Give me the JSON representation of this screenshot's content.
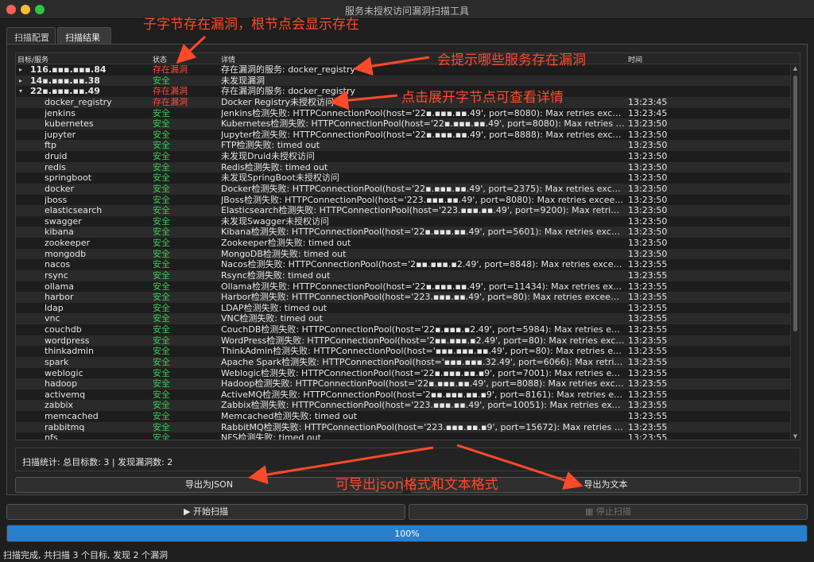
{
  "window": {
    "title": "服务未授权访问漏洞扫描工具",
    "tabs": [
      "扫描配置",
      "扫描结果"
    ],
    "active_tab": "扫描结果"
  },
  "colors": {
    "safe": "#3ccb54",
    "vulnerable": "#ff4c3b",
    "accent": "#2a7fcc",
    "annotation": "#ff4a2a"
  },
  "tree": {
    "headers": {
      "name": "目标/服务",
      "status": "状态",
      "detail": "详情",
      "time": "时间"
    },
    "top": [
      {
        "name": "116.▪▪▪.▪▪▪.84",
        "status": "存在漏洞",
        "status_type": "vuln",
        "detail": "存在漏洞的服务: docker_registry",
        "time": "",
        "caret": "▸"
      },
      {
        "name": "14▪.▪▪▪.▪▪.38",
        "status": "安全",
        "status_type": "safe",
        "detail": "未发现漏洞",
        "time": "",
        "caret": "▸"
      },
      {
        "name": "22▪.▪▪▪.▪▪.49",
        "status": "存在漏洞",
        "status_type": "vuln",
        "detail": "存在漏洞的服务: docker_registry",
        "time": "",
        "caret": "▾"
      }
    ],
    "children": [
      {
        "name": "docker_registry",
        "status": "存在漏洞",
        "status_type": "vuln",
        "detail": "Docker Registry未授权访问",
        "time": "13:23:45"
      },
      {
        "name": "jenkins",
        "status": "安全",
        "status_type": "safe",
        "detail": "Jenkins检测失败: HTTPConnectionPool(host='22▪.▪▪▪.▪▪.49', port=8080): Max retries exceeded wi...",
        "time": "13:23:45"
      },
      {
        "name": "kubernetes",
        "status": "安全",
        "status_type": "safe",
        "detail": "Kubernetes检测失败: HTTPConnectionPool(host='22▪.▪▪▪.▪▪.49', port=8080): Max retries exceede...",
        "time": "13:23:50"
      },
      {
        "name": "jupyter",
        "status": "安全",
        "status_type": "safe",
        "detail": "Jupyter检测失败: HTTPConnectionPool(host='22▪.▪▪▪.▪▪.49', port=8888): Max retries exceeded wi...",
        "time": "13:23:50"
      },
      {
        "name": "ftp",
        "status": "安全",
        "status_type": "safe",
        "detail": "FTP检测失败: timed out",
        "time": "13:23:50"
      },
      {
        "name": "druid",
        "status": "安全",
        "status_type": "safe",
        "detail": "未发现Druid未授权访问",
        "time": "13:23:50"
      },
      {
        "name": "redis",
        "status": "安全",
        "status_type": "safe",
        "detail": "Redis检测失败: timed out",
        "time": "13:23:50"
      },
      {
        "name": "springboot",
        "status": "安全",
        "status_type": "safe",
        "detail": "未发现SpringBoot未授权访问",
        "time": "13:23:50"
      },
      {
        "name": "docker",
        "status": "安全",
        "status_type": "safe",
        "detail": "Docker检测失败: HTTPConnectionPool(host='22▪.▪▪▪.▪▪.49', port=2375): Max retries exceeded wit...",
        "time": "13:23:50"
      },
      {
        "name": "jboss",
        "status": "安全",
        "status_type": "safe",
        "detail": "JBoss检测失败: HTTPConnectionPool(host='223.▪▪▪.▪▪.49', port=8080): Max retries exceeded with...",
        "time": "13:23:50"
      },
      {
        "name": "elasticsearch",
        "status": "安全",
        "status_type": "safe",
        "detail": "Elasticsearch检测失败: HTTPConnectionPool(host='223.▪▪▪.▪▪.49', port=9200): Max retries exceed...",
        "time": "13:23:50"
      },
      {
        "name": "swagger",
        "status": "安全",
        "status_type": "safe",
        "detail": "未发现Swagger未授权访问",
        "time": "13:23:50"
      },
      {
        "name": "kibana",
        "status": "安全",
        "status_type": "safe",
        "detail": "Kibana检测失败: HTTPConnectionPool(host='22▪.▪▪▪.▪▪.49', port=5601): Max retries exceeded wit...",
        "time": "13:23:50"
      },
      {
        "name": "zookeeper",
        "status": "安全",
        "status_type": "safe",
        "detail": "Zookeeper检测失败: timed out",
        "time": "13:23:50"
      },
      {
        "name": "mongodb",
        "status": "安全",
        "status_type": "safe",
        "detail": "MongoDB检测失败: timed out",
        "time": "13:23:50"
      },
      {
        "name": "nacos",
        "status": "安全",
        "status_type": "safe",
        "detail": "Nacos检测失败: HTTPConnectionPool(host='2▪▪.▪▪▪.▪2.49', port=8848): Max retries exceeded with...",
        "time": "13:23:55"
      },
      {
        "name": "rsync",
        "status": "安全",
        "status_type": "safe",
        "detail": "Rsync检测失败: timed out",
        "time": "13:23:55"
      },
      {
        "name": "ollama",
        "status": "安全",
        "status_type": "safe",
        "detail": "Ollama检测失败: HTTPConnectionPool(host='22▪.▪▪▪.▪▪.49', port=11434): Max retries exceeded wit...",
        "time": "13:23:55"
      },
      {
        "name": "harbor",
        "status": "安全",
        "status_type": "safe",
        "detail": "Harbor检测失败: HTTPConnectionPool(host='223.▪▪▪.▪▪.49', port=80): Max retries exceeded with u...",
        "time": "13:23:55"
      },
      {
        "name": "ldap",
        "status": "安全",
        "status_type": "safe",
        "detail": "LDAP检测失败: timed out",
        "time": "13:23:55"
      },
      {
        "name": "vnc",
        "status": "安全",
        "status_type": "safe",
        "detail": "VNC检测失败: timed out",
        "time": "13:23:55"
      },
      {
        "name": "couchdb",
        "status": "安全",
        "status_type": "safe",
        "detail": "CouchDB检测失败: HTTPConnectionPool(host='22▪.▪▪▪.▪2.49', port=5984): Max retries exceeded...",
        "time": "13:23:55"
      },
      {
        "name": "wordpress",
        "status": "安全",
        "status_type": "safe",
        "detail": "WordPress检测失败: HTTPConnectionPool(host='2▪▪.▪▪▪.▪2.49', port=80): Max retries exceeded wi...",
        "time": "13:23:55"
      },
      {
        "name": "thinkadmin",
        "status": "安全",
        "status_type": "safe",
        "detail": "ThinkAdmin检测失败: HTTPConnectionPool(host='▪▪▪.▪▪▪.▪▪.49', port=80): Max retries exceed...",
        "time": "13:23:55"
      },
      {
        "name": "spark",
        "status": "安全",
        "status_type": "safe",
        "detail": "Apache Spark检测失败: HTTPConnectionPool(host='▪▪▪.▪▪▪.32.49', port=6066): Max retries exce...",
        "time": "13:23:55"
      },
      {
        "name": "weblogic",
        "status": "安全",
        "status_type": "safe",
        "detail": "Weblogic检测失败: HTTPConnectionPool(host='22▪.▪▪▪.▪▪.▪9', port=7001): Max retries exceeded wit...",
        "time": "13:23:55"
      },
      {
        "name": "hadoop",
        "status": "安全",
        "status_type": "safe",
        "detail": "Hadoop检测失败: HTTPConnectionPool(host='22▪.▪▪▪.▪▪.49', port=8088): Max retries exceeded wit...",
        "time": "13:23:55"
      },
      {
        "name": "activemq",
        "status": "安全",
        "status_type": "safe",
        "detail": "ActiveMQ检测失败: HTTPConnectionPool(host='2▪▪.▪▪▪.▪▪.▪9', port=8161): Max retries exceeded wi...",
        "time": "13:23:55"
      },
      {
        "name": "zabbix",
        "status": "安全",
        "status_type": "safe",
        "detail": "Zabbix检测失败: HTTPConnectionPool(host='223.▪▪▪.▪▪.49', port=10051): Max retries exceeded wit...",
        "time": "13:23:55"
      },
      {
        "name": "memcached",
        "status": "安全",
        "status_type": "safe",
        "detail": "Memcached检测失败: timed out",
        "time": "13:23:55"
      },
      {
        "name": "rabbitmq",
        "status": "安全",
        "status_type": "safe",
        "detail": "RabbitMQ检测失败: HTTPConnectionPool(host='223.▪▪▪.▪▪.▪9', port=15672): Max retries exceede...",
        "time": "13:23:55"
      },
      {
        "name": "nfs",
        "status": "安全",
        "status_type": "safe",
        "detail": "NFS检测失败: timed out",
        "time": "13:23:55"
      }
    ]
  },
  "stats": {
    "text": "扫描统计: 总目标数: 3 | 发现漏洞数: 2"
  },
  "buttons": {
    "export_json": "导出为JSON",
    "export_text": "导出为文本",
    "start_scan": "▶ 开始扫描",
    "stop_scan": "▦ 停止扫描"
  },
  "progress": {
    "value": 100,
    "label": "100%"
  },
  "statusbar": {
    "text": "扫描完成, 共扫描 3 个目标, 发现 2 个漏洞"
  },
  "annotations": {
    "child_vuln": "子字节存在漏洞，根节点会显示存在",
    "which_services": "会提示哪些服务存在漏洞",
    "expand_details": "点击展开字节点可查看详情",
    "export_formats": "可导出json格式和文本格式"
  }
}
